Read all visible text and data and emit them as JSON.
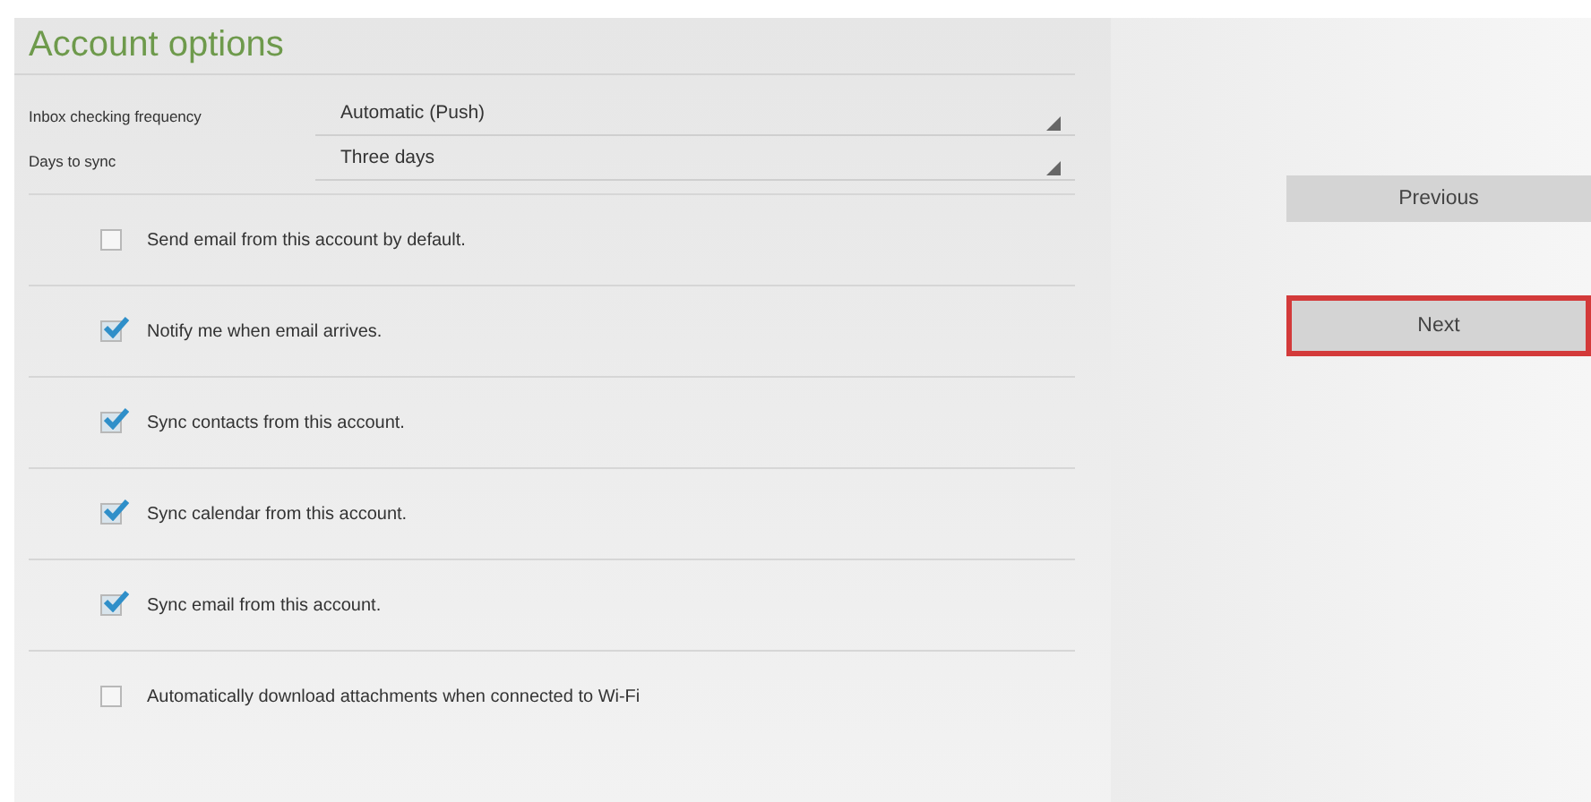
{
  "title": "Account options",
  "settings": [
    {
      "label": "Inbox checking frequency",
      "value": "Automatic (Push)"
    },
    {
      "label": "Days to sync",
      "value": "Three days"
    }
  ],
  "options": [
    {
      "label": "Send email from this account by default.",
      "checked": false
    },
    {
      "label": "Notify me when email arrives.",
      "checked": true
    },
    {
      "label": "Sync contacts from this account.",
      "checked": true
    },
    {
      "label": "Sync calendar from this account.",
      "checked": true
    },
    {
      "label": "Sync email from this account.",
      "checked": true
    },
    {
      "label": "Automatically download attachments when connected to Wi-Fi",
      "checked": false
    }
  ],
  "buttons": [
    {
      "label": "Previous",
      "highlighted": false
    },
    {
      "label": "Next",
      "highlighted": true
    }
  ]
}
